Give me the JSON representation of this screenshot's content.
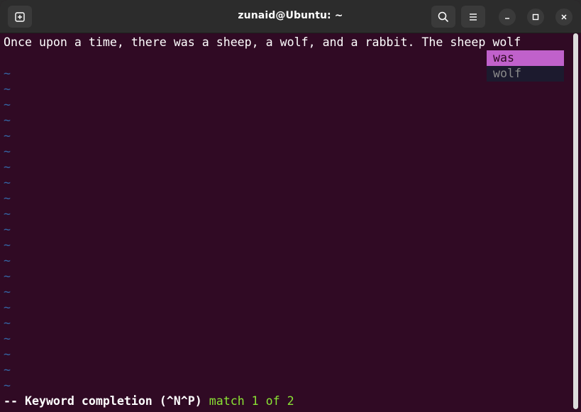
{
  "window": {
    "title": "zunaid@Ubuntu: ~"
  },
  "titlebar": {
    "new_tab_icon": "new-tab-icon",
    "search_icon": "search-icon",
    "menu_icon": "hamburger-menu-icon",
    "minimize_icon": "minimize-icon",
    "maximize_icon": "maximize-icon",
    "close_icon": "close-icon"
  },
  "editor": {
    "line1": "Once upon a time, there was a sheep, a wolf, and a rabbit. The sheep wolf",
    "tilde": "~",
    "empty_line_count": 21
  },
  "completion_popup": {
    "items": [
      "was",
      "wolf"
    ],
    "selected_index": 0
  },
  "status": {
    "mode": "-- Keyword completion (^N^P)",
    "match": "match 1 of 2"
  },
  "colors": {
    "background": "#300a24",
    "titlebar": "#2c2c2c",
    "tilde": "#3465a4",
    "popup_selected": "#c061cb",
    "popup_other": "#1c1a2e",
    "match_text": "#8ae234"
  }
}
